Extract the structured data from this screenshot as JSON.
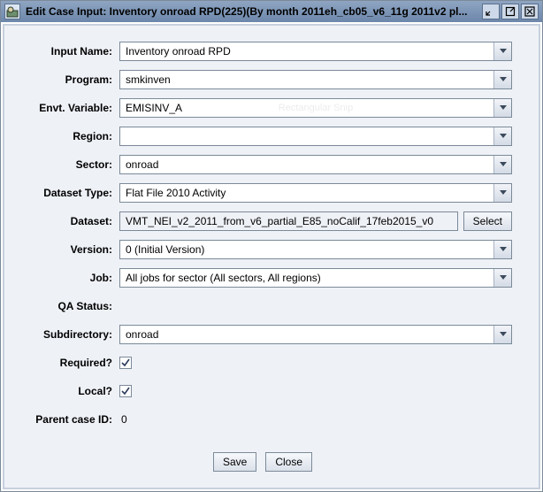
{
  "titlebar": {
    "title": "Edit Case Input: Inventory onroad RPD(225)(By month 2011eh_cb05_v6_11g 2011v2 pl..."
  },
  "form": {
    "inputName": {
      "label": "Input Name:",
      "value": "Inventory onroad RPD"
    },
    "program": {
      "label": "Program:",
      "value": "smkinven"
    },
    "envtVar": {
      "label": "Envt. Variable:",
      "value": "EMISINV_A",
      "watermark": "Rectangular Snip"
    },
    "region": {
      "label": "Region:",
      "value": ""
    },
    "sector": {
      "label": "Sector:",
      "value": "onroad"
    },
    "datasetType": {
      "label": "Dataset Type:",
      "value": "Flat File 2010 Activity"
    },
    "dataset": {
      "label": "Dataset:",
      "value": "VMT_NEI_v2_2011_from_v6_partial_E85_noCalif_17feb2015_v0",
      "selectLabel": "Select"
    },
    "version": {
      "label": "Version:",
      "value": "0 (Initial Version)"
    },
    "job": {
      "label": "Job:",
      "value": "All jobs for sector (All sectors, All regions)"
    },
    "qaStatus": {
      "label": "QA Status:",
      "value": ""
    },
    "subdirectory": {
      "label": "Subdirectory:",
      "value": "onroad"
    },
    "required": {
      "label": "Required?",
      "checked": true
    },
    "local": {
      "label": "Local?",
      "checked": true
    },
    "parentCaseId": {
      "label": "Parent case ID:",
      "value": "0"
    }
  },
  "buttons": {
    "save": "Save",
    "close": "Close"
  }
}
